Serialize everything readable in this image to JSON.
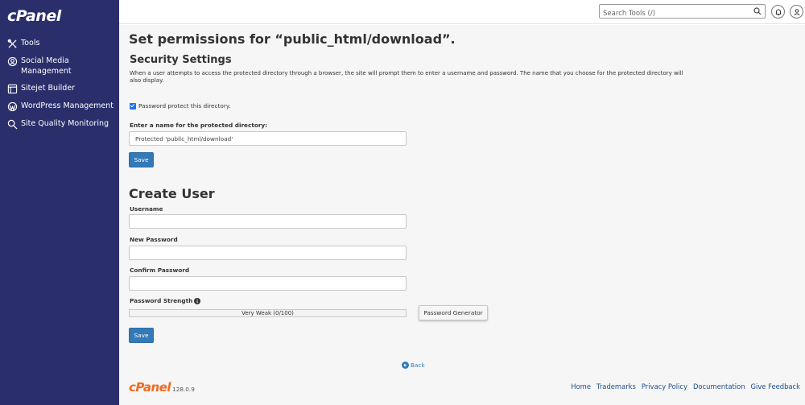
{
  "sidebar": {
    "logo": "cPanel",
    "items": [
      {
        "label": "Tools",
        "icon": "tools-icon"
      },
      {
        "label": "Social Media Management",
        "icon": "social-icon"
      },
      {
        "label": "Sitejet Builder",
        "icon": "sitejet-icon"
      },
      {
        "label": "WordPress Management",
        "icon": "wordpress-icon"
      },
      {
        "label": "Site Quality Monitoring",
        "icon": "monitor-icon"
      }
    ]
  },
  "topbar": {
    "search_placeholder": "Search Tools (/)"
  },
  "page": {
    "title_prefix": "Set permissions for “",
    "title_path": "public_html/download",
    "title_suffix": "”.",
    "security": {
      "heading": "Security Settings",
      "description": "When a user attempts to access the protected directory through a browser, the site will prompt them to enter a username and password. The name that you choose for the protected directory will also display.",
      "checkbox_label": "Password protect this directory.",
      "checkbox_checked": true,
      "name_label": "Enter a name for the protected directory:",
      "name_value": "Protected 'public_html/download'",
      "save_label": "Save"
    },
    "create_user": {
      "heading": "Create User",
      "username_label": "Username",
      "username_value": "",
      "new_password_label": "New Password",
      "new_password_value": "",
      "confirm_password_label": "Confirm Password",
      "confirm_password_value": "",
      "strength_label": "Password Strength",
      "strength_text": "Very Weak (0/100)",
      "strength_value": 0,
      "generator_label": "Password Generator",
      "save_label": "Save"
    },
    "back_label": "Back"
  },
  "footer": {
    "brand": "cPanel",
    "version": "128.0.9",
    "links": [
      "Home",
      "Trademarks",
      "Privacy Policy",
      "Documentation",
      "Give Feedback"
    ]
  }
}
